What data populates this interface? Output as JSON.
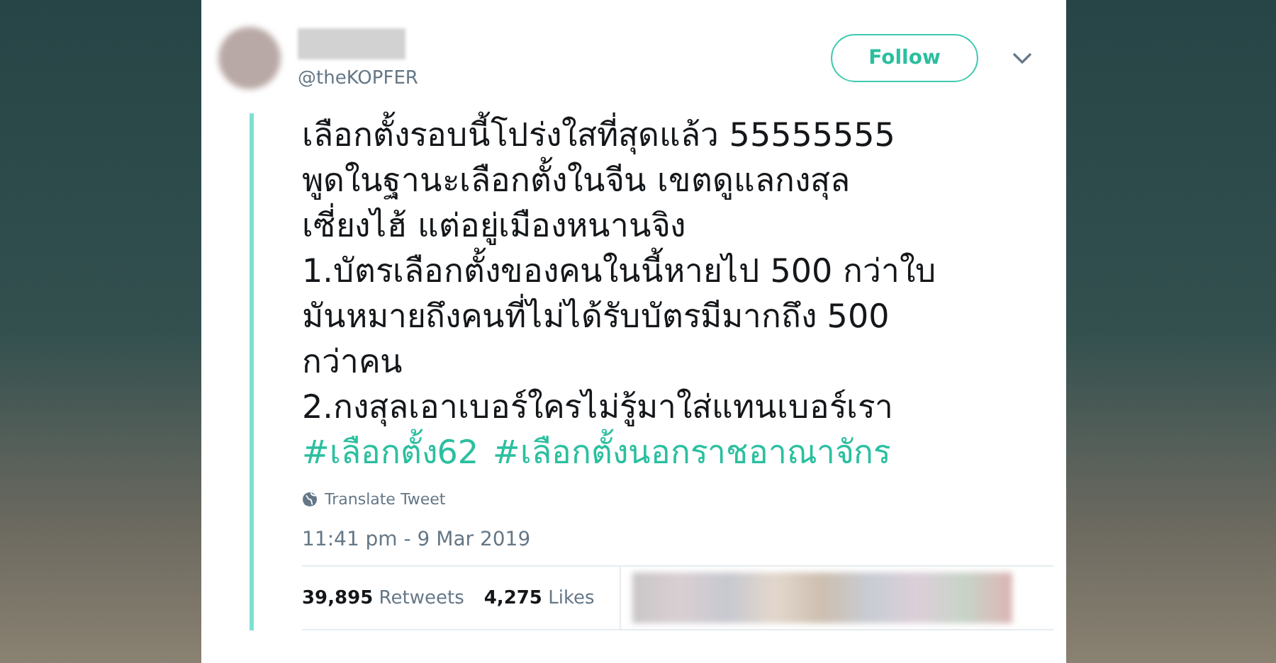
{
  "tweet": {
    "handle": "@theKOPFER",
    "follow_button": "Follow",
    "text_lines": [
      "เลือกตั้งรอบนี้โปร่งใสที่สุดแล้ว 55555555",
      "พูดในฐานะเลือกตั้งในจีน เขตดูแลกงสุล",
      "เซี่ยงไฮ้ แต่อยู่เมืองหนานจิง",
      "1.บัตรเลือกตั้งของคนในนี้หายไป 500 กว่าใบ",
      "มันหมายถึงคนที่ไม่ได้รับบัตรมีมากถึง 500",
      "กว่าคน",
      "2.กงสุลเอาเบอร์ใครไม่รู้มาใส่แทนเบอร์เรา"
    ],
    "hashtags": [
      "#เลือกตั้ง62",
      "#เลือกตั้งนอกราชอาณาจักร"
    ],
    "translate": "Translate Tweet",
    "timestamp": "11:41 pm - 9 Mar 2019",
    "stats": [
      {
        "count": "39,895",
        "label": "Retweets"
      },
      {
        "count": "4,275",
        "label": "Likes"
      }
    ]
  }
}
